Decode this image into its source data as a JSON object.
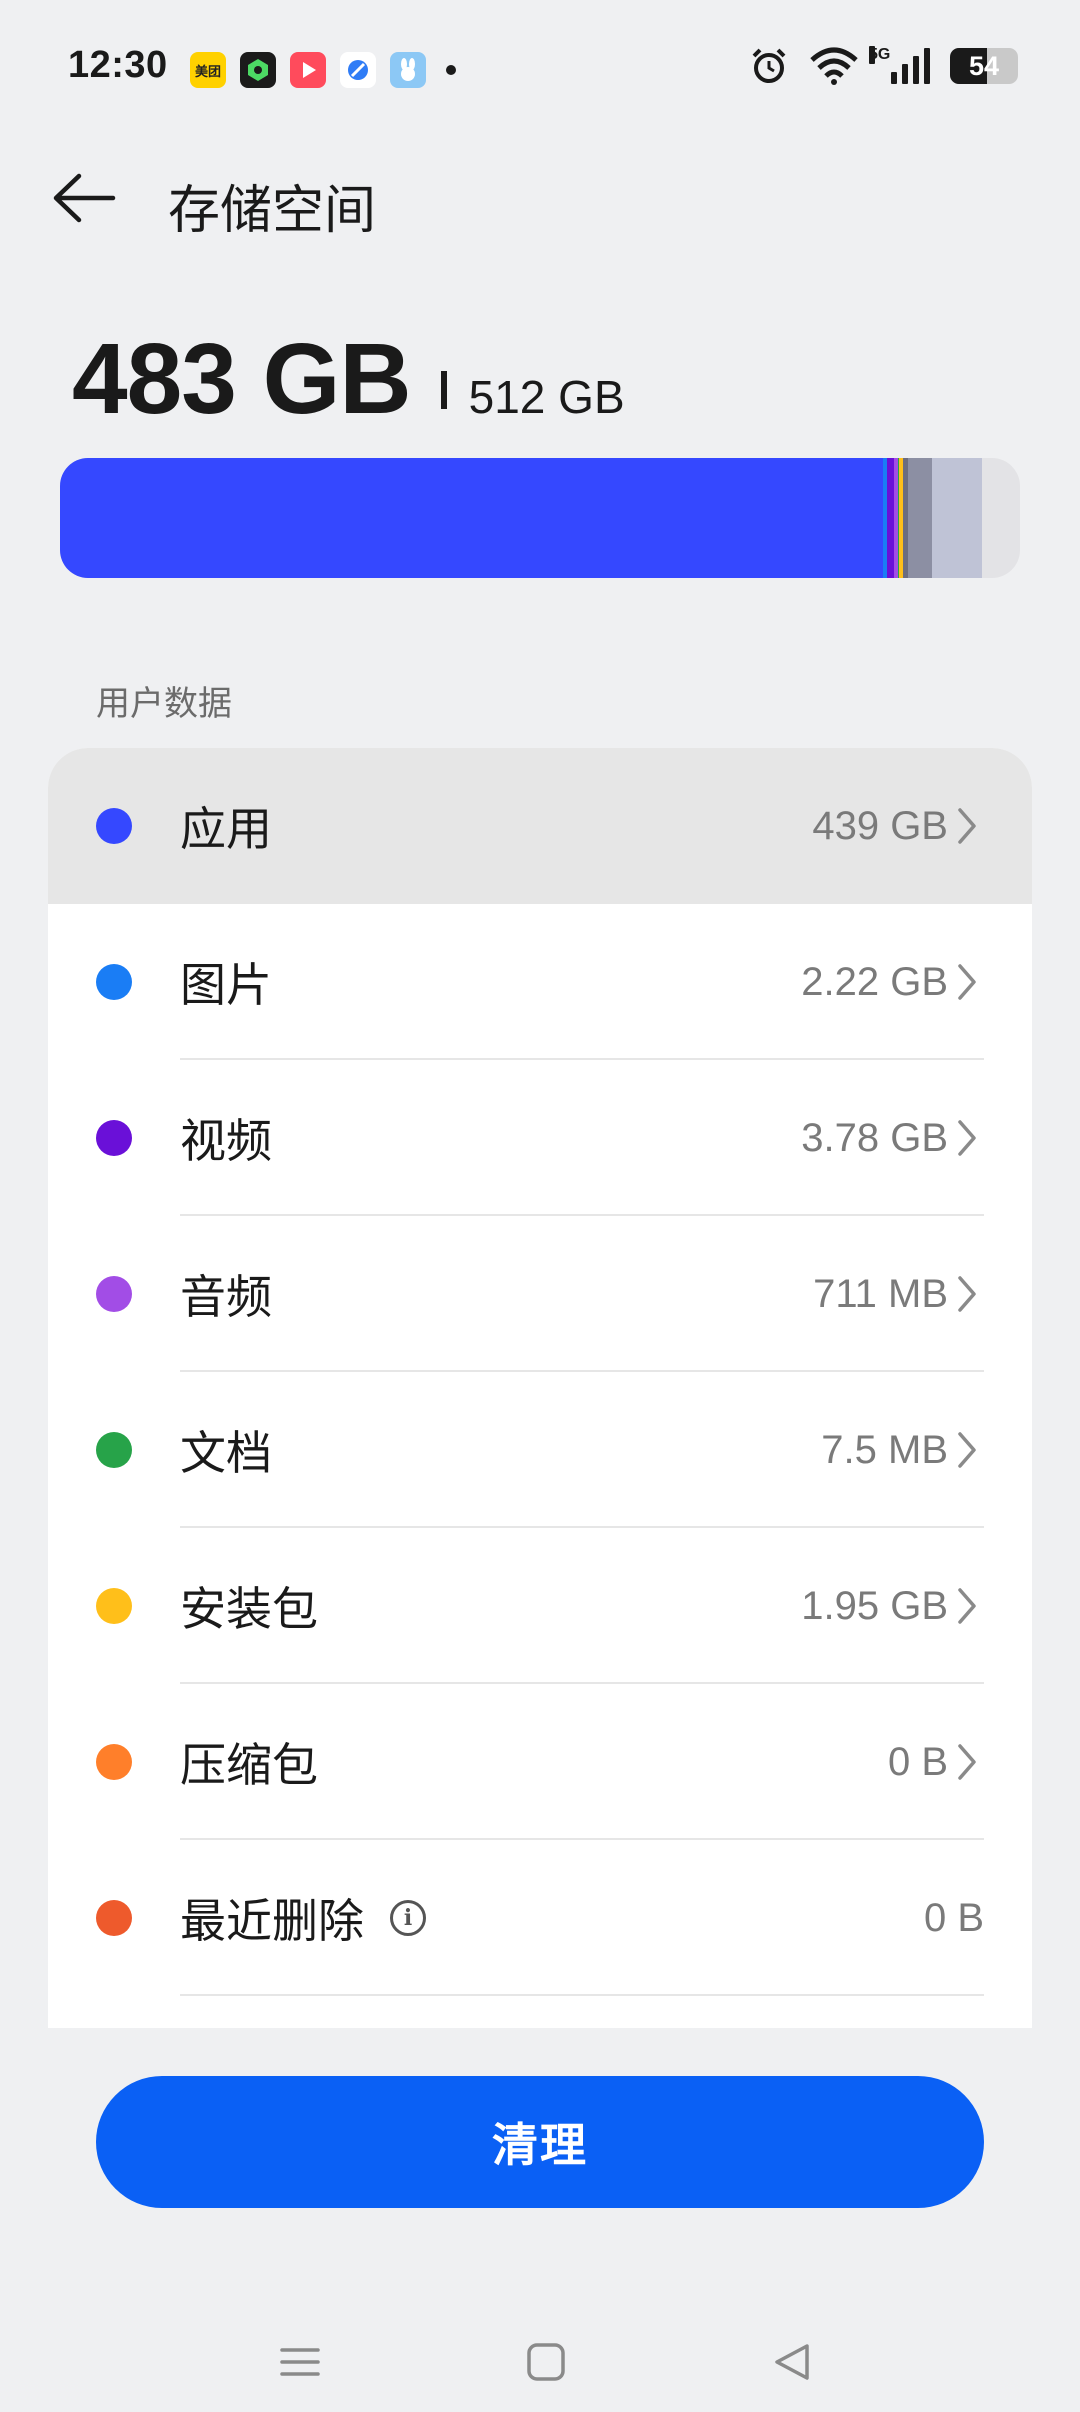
{
  "status_bar": {
    "time": "12:30",
    "notification_icons": [
      "meituan-icon",
      "green-app-icon",
      "video-play-icon",
      "browser-icon",
      "bunny-app-icon"
    ],
    "meituan_label": "美团",
    "network": "5G",
    "battery": "54"
  },
  "header": {
    "title": "存储空间"
  },
  "summary": {
    "used": "483 GB",
    "total": "512 GB",
    "used_fraction": 0.943
  },
  "storage_bar_segments": [
    {
      "category": "应用",
      "color": "#3548ff",
      "fraction": 0.857
    },
    {
      "category": "图片",
      "color": "#1a7df5",
      "fraction": 0.0043
    },
    {
      "category": "视频",
      "color": "#6a10d8",
      "fraction": 0.0074
    },
    {
      "category": "音频",
      "color": "#a24de6",
      "fraction": 0.004
    },
    {
      "category": "文档",
      "color": "#27a349",
      "fraction": 0.001
    },
    {
      "category": "安装包",
      "color": "#ffbf1a",
      "fraction": 0.004
    },
    {
      "category": "system",
      "color": "#6c6d80",
      "fraction": 0.006
    },
    {
      "category": "other",
      "color": "#8c8fa3",
      "fraction": 0.025
    },
    {
      "category": "other2",
      "color": "#bfc3d6",
      "fraction": 0.052
    }
  ],
  "section": {
    "label": "用户数据"
  },
  "categories": [
    {
      "name": "应用",
      "value": "439 GB",
      "color": "#3548ff",
      "chevron": true,
      "pressed": true
    },
    {
      "name": "图片",
      "value": "2.22 GB",
      "color": "#1a7df5",
      "chevron": true
    },
    {
      "name": "视频",
      "value": "3.78 GB",
      "color": "#6a10d8",
      "chevron": true
    },
    {
      "name": "音频",
      "value": "711 MB",
      "color": "#a24de6",
      "chevron": true
    },
    {
      "name": "文档",
      "value": "7.5 MB",
      "color": "#27a349",
      "chevron": true
    },
    {
      "name": "安装包",
      "value": "1.95 GB",
      "color": "#ffbf1a",
      "chevron": true
    },
    {
      "name": "压缩包",
      "value": "0 B",
      "color": "#ff7f2a",
      "chevron": true
    },
    {
      "name": "最近删除",
      "value": "0 B",
      "color": "#ee5a2c",
      "chevron": false,
      "info_icon": true
    }
  ],
  "actions": {
    "clean_label": "清理"
  },
  "nav": [
    "menu-icon",
    "home-icon",
    "back-triangle-icon"
  ]
}
